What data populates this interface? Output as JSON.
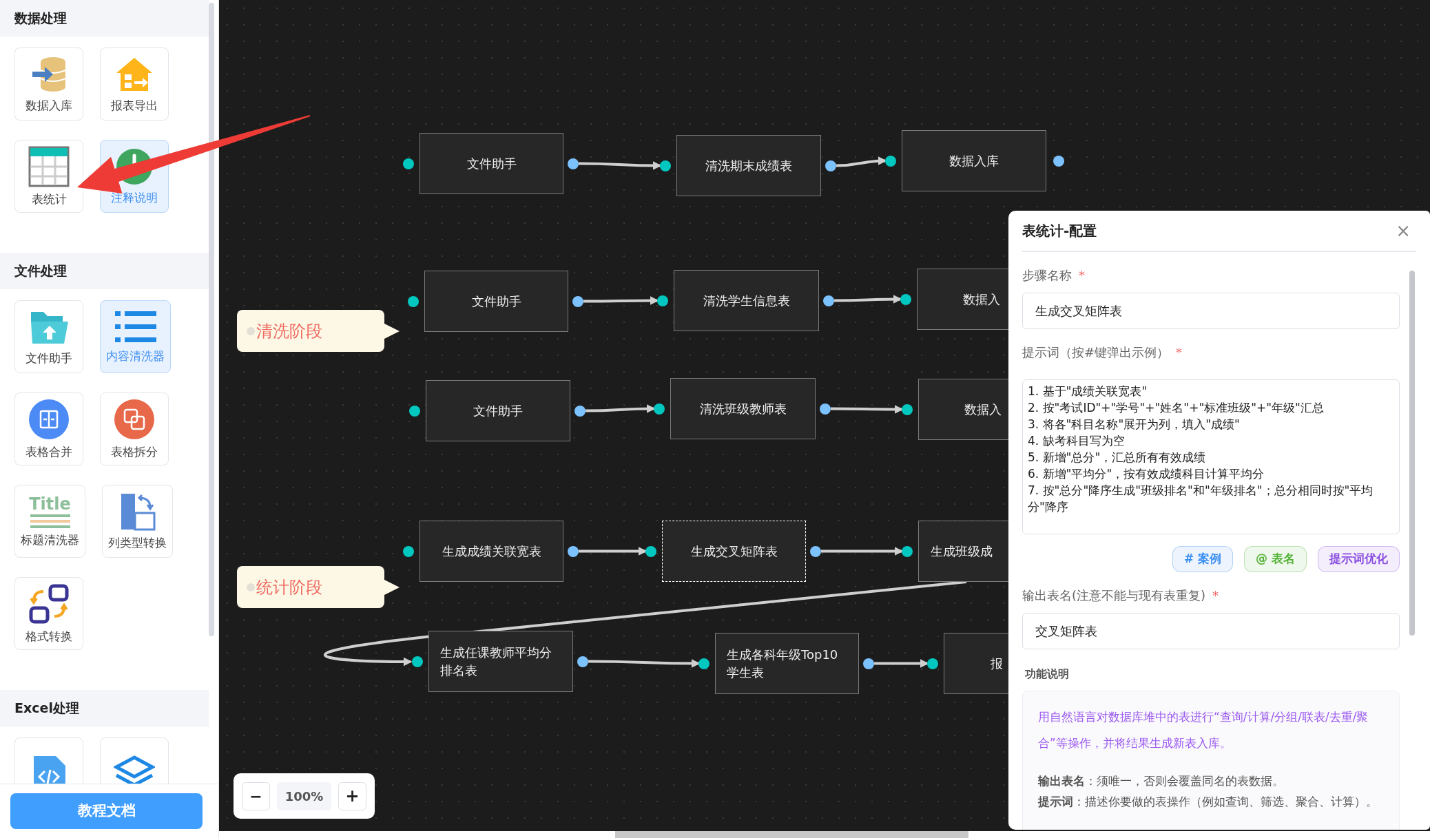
{
  "sidebar": {
    "sections": [
      {
        "title": "数据处理",
        "items": [
          {
            "label": "数据入库",
            "selected": false
          },
          {
            "label": "报表导出",
            "selected": false
          },
          {
            "label": "表统计",
            "selected": false
          },
          {
            "label": "注释说明",
            "selected": true
          }
        ]
      },
      {
        "title": "文件处理",
        "items": [
          {
            "label": "文件助手",
            "selected": false
          },
          {
            "label": "内容清洗器",
            "selected": true
          },
          {
            "label": "表格合并",
            "selected": false
          },
          {
            "label": "表格拆分",
            "selected": false
          },
          {
            "label": "标题清洗器",
            "icon_text": "Title",
            "selected": false
          },
          {
            "label": "列类型转换",
            "selected": false
          },
          {
            "label": "格式转换",
            "selected": false
          }
        ]
      },
      {
        "title": "Excel处理",
        "items": [
          {
            "selected": false
          },
          {
            "selected": false
          }
        ]
      }
    ],
    "doc_button": "教程文档"
  },
  "canvas": {
    "flows": [
      {
        "nodes": [
          {
            "label": "文件助手",
            "selected": false
          },
          {
            "label": "清洗期末成绩表",
            "selected": false
          },
          {
            "label": "数据入库",
            "selected": false
          }
        ]
      },
      {
        "nodes": [
          {
            "label": "文件助手",
            "selected": false
          },
          {
            "label": "清洗学生信息表",
            "selected": false
          },
          {
            "label": "数据入",
            "selected": false
          }
        ]
      },
      {
        "nodes": [
          {
            "label": "文件助手",
            "selected": false
          },
          {
            "label": "清洗班级教师表",
            "selected": false
          },
          {
            "label": "数据入",
            "selected": false
          }
        ]
      },
      {
        "nodes": [
          {
            "label": "生成成绩关联宽表",
            "selected": false
          },
          {
            "label": "生成交叉矩阵表",
            "selected": true
          },
          {
            "label": "生成班级成",
            "selected": false
          }
        ]
      },
      {
        "nodes": [
          {
            "label": "生成任课教师平均分排名表",
            "selected": false
          },
          {
            "label": "生成各科年级Top10学生表",
            "selected": false
          },
          {
            "label": "报",
            "selected": false
          }
        ]
      }
    ],
    "phase_labels": [
      "清洗阶段",
      "统计阶段"
    ],
    "zoom": {
      "zoom_out": "−",
      "value": "100%",
      "zoom_in": "+"
    }
  },
  "config_panel": {
    "title": "表统计-配置",
    "close": "×",
    "fields": [
      {
        "kind": "input",
        "label": "步骤名称",
        "required_mark": "*",
        "value": "生成交叉矩阵表"
      },
      {
        "kind": "textarea",
        "label": "提示词（按#键弹出示例）",
        "required_mark": "*",
        "value": "1. 基于\"成绩关联宽表\"\n2. 按\"考试ID\"+\"学号\"+\"姓名\"+\"标准班级\"+\"年级\"汇总\n3. 将各\"科目名称\"展开为列，填入\"成绩\"\n4. 缺考科目写为空\n5. 新增\"总分\"，汇总所有有效成绩\n6. 新增\"平均分\"，按有效成绩科目计算平均分\n7. 按\"总分\"降序生成\"班级排名\"和\"年级排名\"；总分相同时按\"平均分\"降序",
        "actions": [
          {
            "label": "# 案例",
            "color": "#3b8ff0"
          },
          {
            "label": "@ 表名",
            "color": "#52b236"
          },
          {
            "label": "提示词优化",
            "color": "#8a4fe0"
          }
        ]
      },
      {
        "kind": "input",
        "label": "输出表名(注意不能与现有表重复)",
        "required_mark": "*",
        "value": "交叉矩阵表"
      }
    ],
    "description": {
      "title": "功能说明",
      "summary": "用自然语言对数据库堆中的表进行“查询/计算/分组/联表/去重/聚合”等操作，并将结果生成新表入库。",
      "notes": [
        "**输出表名**：须唯一，否则会覆盖同名的表数据。",
        "**提示词**：描述你要做的表操作（例如查询、筛选、聚合、计算）。"
      ]
    }
  }
}
